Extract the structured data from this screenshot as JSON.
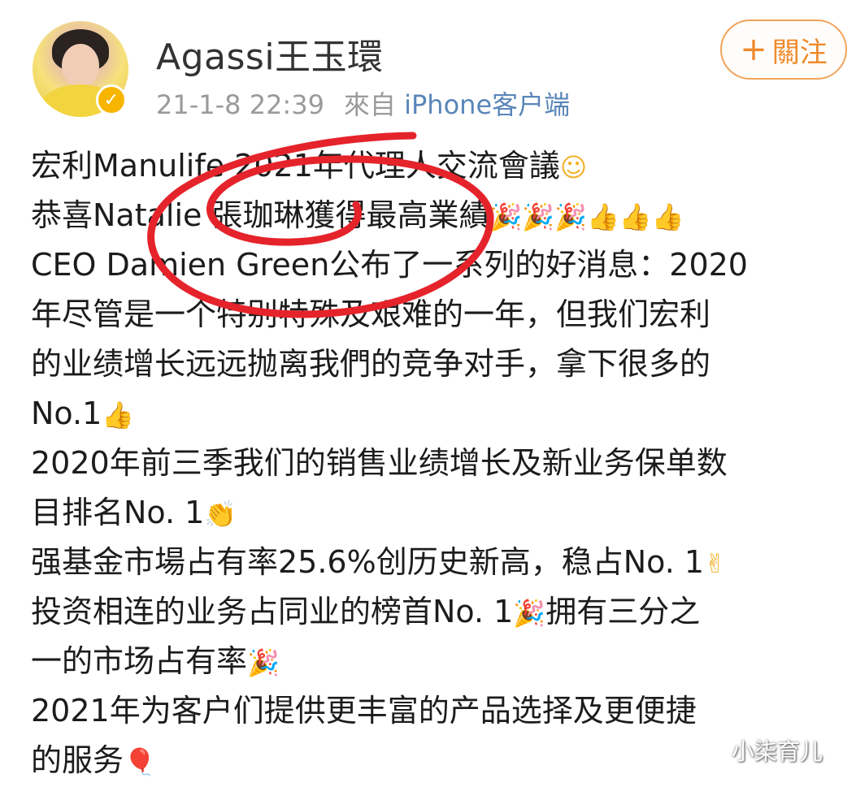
{
  "post": {
    "username": "Agassi王玉環",
    "timestamp": "21-1-8 22:39",
    "source_prefix": "來自",
    "source": "iPhone客户端",
    "follow_label": "關注",
    "lines": [
      {
        "text": "宏利Manulife 2021年代理人交流會議",
        "emoji": [
          "smile"
        ]
      },
      {
        "text": "恭喜Natalie 張珈琳獲得最高業績",
        "emoji": [
          "party",
          "party",
          "party",
          "thumbs-up",
          "thumbs-up",
          "thumbs-up"
        ]
      },
      {
        "text": "CEO Damien Green公布了一系列的好消息：2020",
        "emoji": []
      },
      {
        "text": "年尽管是一个特别特殊及艰难的一年，但我们宏利",
        "emoji": []
      },
      {
        "text": "的业绩增长远远抛离我們的竞争对手，拿下很多的",
        "emoji": []
      },
      {
        "text": "No.1",
        "emoji": [
          "thumbs-up"
        ]
      },
      {
        "text": "2020年前三季我们的销售业绩增长及新业务保单数",
        "emoji": []
      },
      {
        "text": "目排名No. 1",
        "emoji": [
          "clap"
        ]
      },
      {
        "text": "强基金市場占有率25.6%创历史新高，稳占No. 1",
        "emoji": [
          "victory"
        ]
      },
      {
        "text": "投资相连的业务占同业的榜首No. 1",
        "emoji": [
          "party"
        ],
        "suffix": "拥有三分之"
      },
      {
        "text": "一的市场占有率",
        "emoji": [
          "party"
        ]
      },
      {
        "text": " 2021年为客户们提供更丰富的产品选择及更便捷",
        "emoji": []
      },
      {
        "text": "的服务",
        "emoji": [
          "balloon"
        ]
      }
    ]
  },
  "watermark": "小柒育儿",
  "colors": {
    "follow_border": "#f2a35a",
    "follow_text": "#ef8a2c",
    "source_link": "#5a86b8",
    "annotation_circle": "#e5232b",
    "verified_badge": "#f7b500"
  },
  "icons": {
    "smile": "smiling-face-icon",
    "party": "party-popper-icon",
    "thumbs-up": "thumbs-up-icon",
    "clap": "clapping-hands-icon",
    "victory": "victory-hand-icon",
    "balloon": "balloon-icon",
    "verified": "verified-badge-icon",
    "plus": "plus-icon"
  }
}
